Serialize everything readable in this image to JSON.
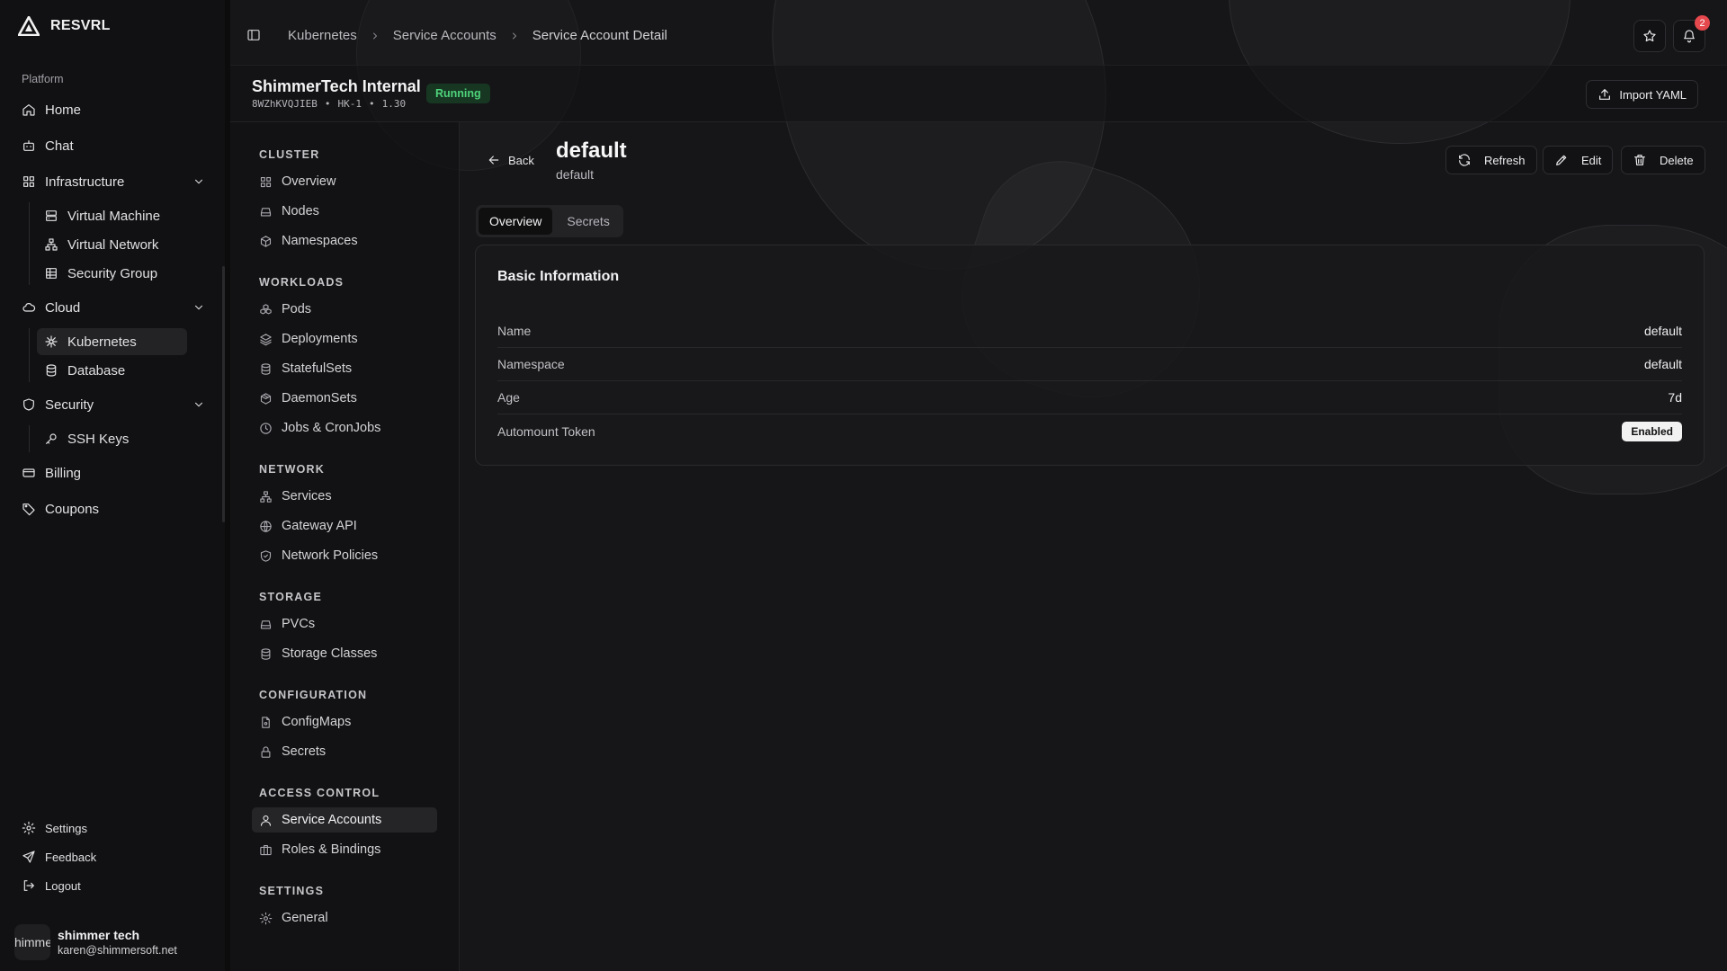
{
  "brand": {
    "name": "RESVRL"
  },
  "sidebar": {
    "group_label": "Platform",
    "home": "Home",
    "chat": "Chat",
    "infrastructure": {
      "label": "Infrastructure",
      "items": [
        "Virtual Machine",
        "Virtual Network",
        "Security Group"
      ]
    },
    "cloud": {
      "label": "Cloud",
      "items": [
        "Kubernetes",
        "Database"
      ],
      "active": "Kubernetes"
    },
    "security": {
      "label": "Security",
      "items": [
        "SSH Keys"
      ]
    },
    "billing": "Billing",
    "coupons": "Coupons",
    "footer": {
      "settings": "Settings",
      "feedback": "Feedback",
      "logout": "Logout"
    },
    "user": {
      "avatar_text": "himme",
      "name": "shimmer tech",
      "email": "karen@shimmersoft.net"
    }
  },
  "breadcrumb": [
    "Kubernetes",
    "Service Accounts",
    "Service Account Detail"
  ],
  "notifications": {
    "count": "2"
  },
  "cluster": {
    "name": "ShimmerTech Internal",
    "id": "8WZhKVQJIEB",
    "region": "HK-1",
    "version": "1.30",
    "status": "Running",
    "import_label": "Import YAML"
  },
  "subnav": {
    "cluster": {
      "label": "CLUSTER",
      "items": [
        "Overview",
        "Nodes",
        "Namespaces"
      ]
    },
    "workloads": {
      "label": "WORKLOADS",
      "items": [
        "Pods",
        "Deployments",
        "StatefulSets",
        "DaemonSets",
        "Jobs & CronJobs"
      ]
    },
    "network": {
      "label": "NETWORK",
      "items": [
        "Services",
        "Gateway API",
        "Network Policies"
      ]
    },
    "storage": {
      "label": "STORAGE",
      "items": [
        "PVCs",
        "Storage Classes"
      ]
    },
    "configuration": {
      "label": "CONFIGURATION",
      "items": [
        "ConfigMaps",
        "Secrets"
      ]
    },
    "access": {
      "label": "ACCESS CONTROL",
      "items": [
        "Service Accounts",
        "Roles & Bindings"
      ]
    },
    "settings": {
      "label": "SETTINGS",
      "items": [
        "General"
      ]
    },
    "active": "Service Accounts"
  },
  "detail": {
    "back_label": "Back",
    "title": "default",
    "subtitle": "default",
    "actions": {
      "refresh": "Refresh",
      "edit": "Edit",
      "delete": "Delete"
    },
    "tabs": [
      "Overview",
      "Secrets"
    ],
    "active_tab": "Overview",
    "card_title": "Basic Information",
    "fields": [
      {
        "label": "Name",
        "value": "default"
      },
      {
        "label": "Namespace",
        "value": "default"
      },
      {
        "label": "Age",
        "value": "7d"
      },
      {
        "label": "Automount Token",
        "value": "Enabled"
      }
    ]
  },
  "colors": {
    "status_green": "#4fd37b",
    "badge_red": "#e5484d",
    "background": "#161618"
  }
}
